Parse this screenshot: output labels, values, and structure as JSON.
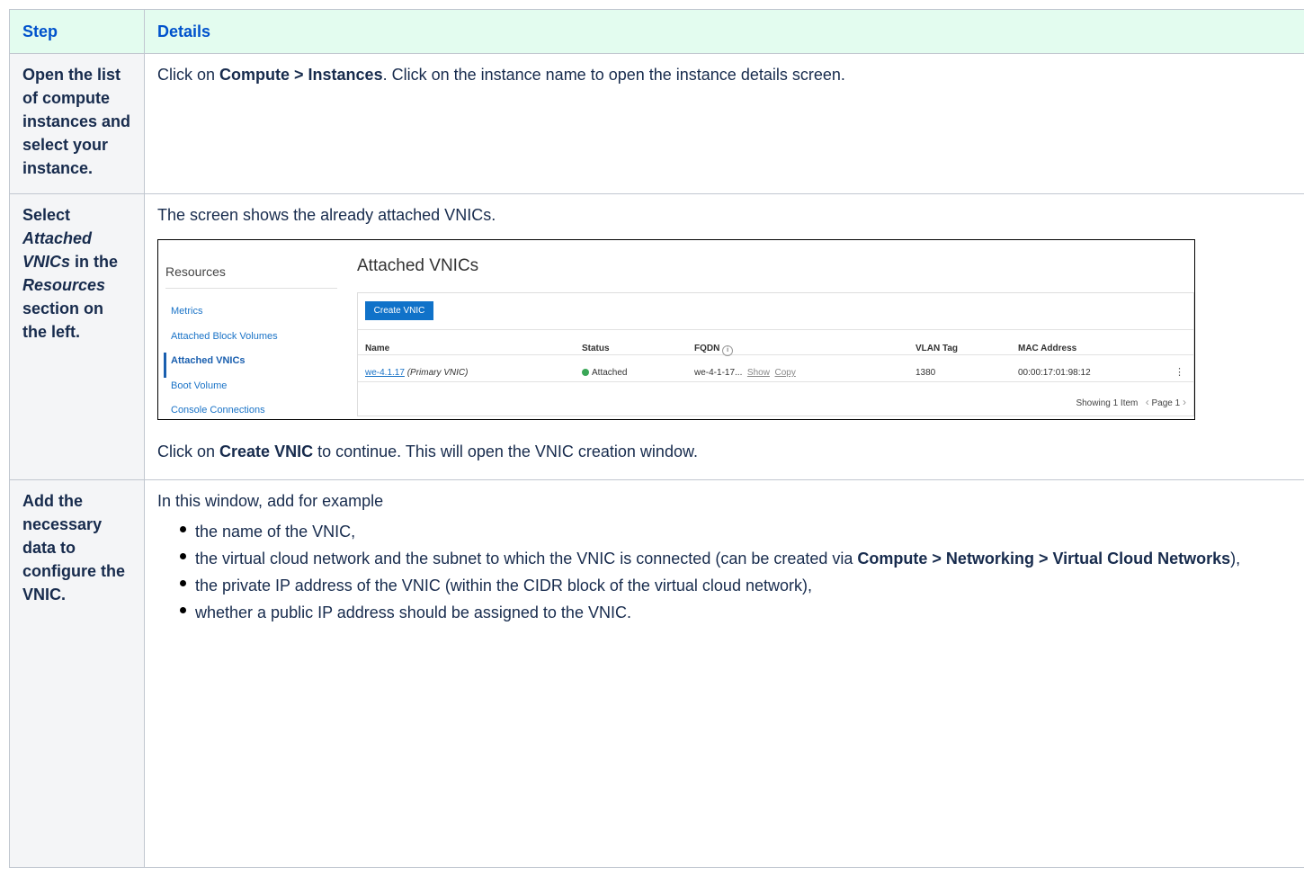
{
  "table": {
    "headers": {
      "step": "Step",
      "details": "Details"
    },
    "rows": [
      {
        "step": "Open the list of compute instances and select your instance.",
        "details": {
          "pre": "Click on ",
          "bold": "Compute > Instances",
          "post": ". Click on the instance name to open the instance details screen."
        }
      },
      {
        "step_parts": {
          "a": "Select ",
          "b": "Attached VNICs",
          "c": " in the ",
          "d": "Resources",
          "e": " section on the left."
        },
        "details": {
          "intro": "The screen shows the already attached VNICs.",
          "outro_pre": "Click on ",
          "outro_bold": "Create VNIC",
          "outro_post": " to continue. This will open the VNIC creation window."
        }
      },
      {
        "step": "Add the necessary data to configure the VNIC.",
        "details": {
          "intro": "In this window, add for example",
          "bullets": {
            "b1": "the name of the VNIC,",
            "b2_pre": "the virtual cloud network and the subnet to which the VNIC is connected (can be created via ",
            "b2_bold": "Compute > Networking > Virtual Cloud Networks",
            "b2_post": "),",
            "b3": "the private IP address of the VNIC (within the CIDR block of the virtual cloud network),",
            "b4": "whether a public IP address should be assigned to the VNIC."
          }
        }
      }
    ]
  },
  "screenshot": {
    "resources_title": "Resources",
    "resources_items": [
      "Metrics",
      "Attached Block Volumes",
      "Attached VNICs",
      "Boot Volume",
      "Console Connections"
    ],
    "panel_title": "Attached VNICs",
    "create_button": "Create VNIC",
    "columns": {
      "name": "Name",
      "status": "Status",
      "fqdn": "FQDN",
      "vlan": "VLAN Tag",
      "mac": "MAC Address"
    },
    "row": {
      "name_link": "we-4.1.17",
      "name_note": "(Primary VNIC)",
      "status": "Attached",
      "fqdn": "we-4-1-17...",
      "fqdn_show": "Show",
      "fqdn_copy": "Copy",
      "vlan": "1380",
      "mac": "00:00:17:01:98:12"
    },
    "footer": {
      "showing": "Showing 1 Item",
      "page": "Page 1"
    },
    "status_color": "#3aa757",
    "button_color": "#1072c9"
  }
}
